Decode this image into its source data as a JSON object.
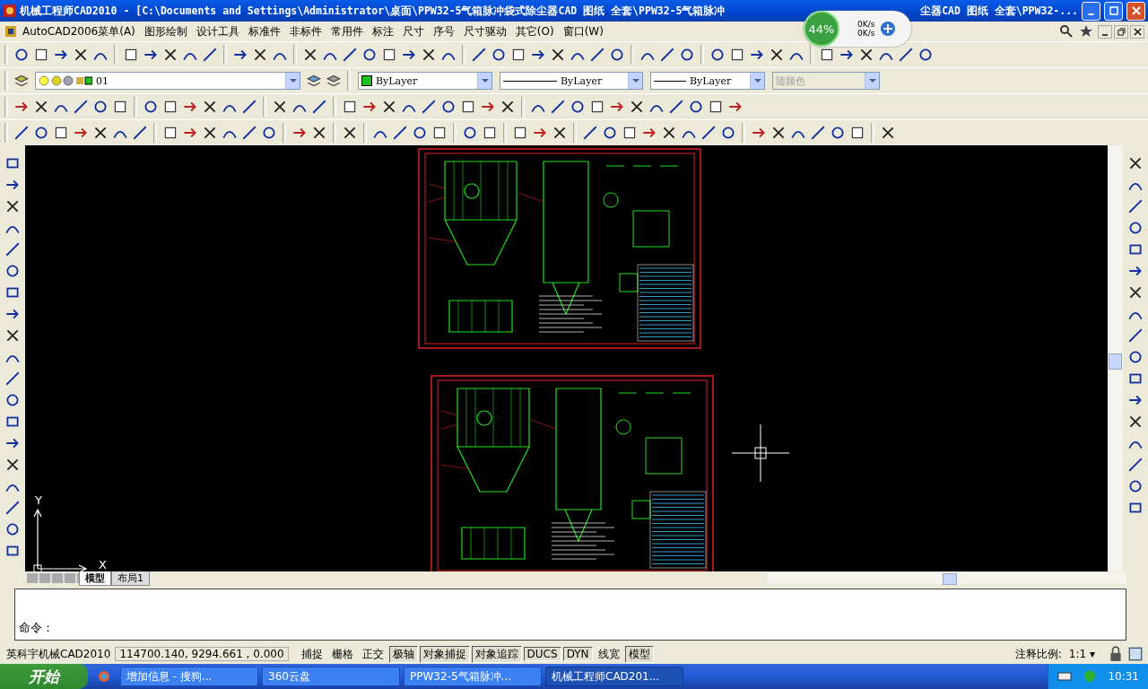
{
  "window": {
    "title_start": "机械工程师CAD2010 - [C:\\Documents and Settings\\Administrator\\桌面\\PPW32-5气箱脉冲袋式除尘器CAD  图纸  全套\\PPW32-5气箱脉冲",
    "title_end": "尘器CAD  图纸  全套\\PPW32-..."
  },
  "net_widget": {
    "percent": "44%",
    "upload": "0K/s",
    "download": "0K/s"
  },
  "menu": [
    "AutoCAD2006菜单(A)",
    "图形绘制",
    "设计工具",
    "标准件",
    "非标件",
    "常用件",
    "标注",
    "尺寸",
    "序号",
    "尺寸驱动",
    "其它(O)",
    "窗口(W)"
  ],
  "properties": {
    "layer": "01",
    "color_label": "ByLayer",
    "linetype": "ByLayer",
    "lineweight": "ByLayer",
    "plotstyle": {
      "label": "随颜色",
      "disabled": true
    }
  },
  "canvas": {
    "ucs_x": "X",
    "ucs_y": "Y"
  },
  "layout_tabs": [
    {
      "label": "模型",
      "selected": true
    },
    {
      "label": "布局1",
      "selected": false
    }
  ],
  "command": {
    "prompt": "命令："
  },
  "status_bar": {
    "product": "英科宇机械CAD2010",
    "coordinates": "114700.140, 9294.661 , 0.000",
    "toggles": [
      {
        "label": "捕捉",
        "on": false
      },
      {
        "label": "栅格",
        "on": false
      },
      {
        "label": "正交",
        "on": false
      },
      {
        "label": "极轴",
        "on": true
      },
      {
        "label": "对象捕捉",
        "on": true
      },
      {
        "label": "对象追踪",
        "on": true
      },
      {
        "label": "DUCS",
        "on": true
      },
      {
        "label": "DYN",
        "on": true
      },
      {
        "label": "线宽",
        "on": false
      },
      {
        "label": "模型",
        "on": true
      }
    ],
    "scale_label": "注释比例:",
    "scale_value": "1:1 ▾"
  },
  "taskbar": {
    "start": "开始",
    "tasks": [
      {
        "label": "增加信息 - 搜狗...",
        "selected": false
      },
      {
        "label": "360云盘",
        "selected": false
      },
      {
        "label": "PPW32-5气箱脉冲...",
        "selected": false
      },
      {
        "label": "机械工程师CAD201...",
        "selected": true
      }
    ],
    "clock": "10:31"
  }
}
